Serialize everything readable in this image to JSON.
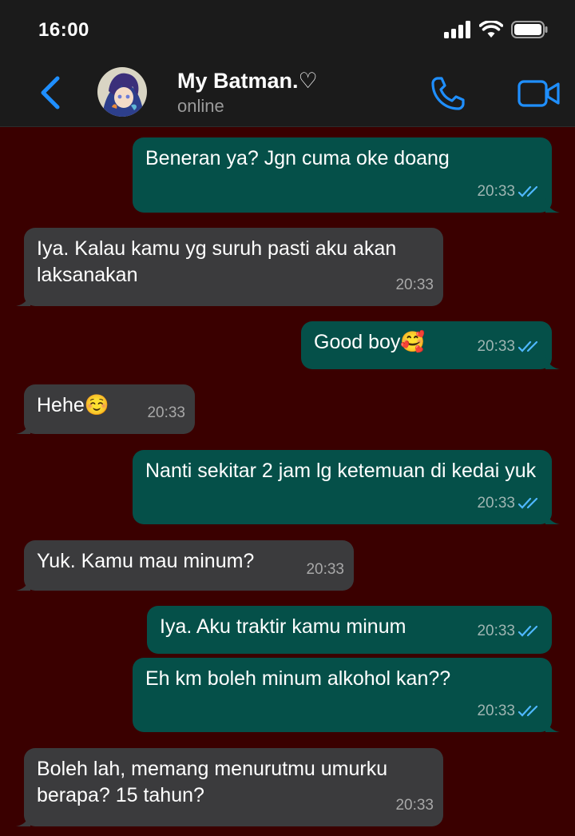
{
  "status_bar": {
    "time": "16:00"
  },
  "header": {
    "contact_name": "My Batman.♡",
    "status": "online"
  },
  "messages": [
    {
      "dir": "out",
      "text": "Beneran ya? Jgn cuma oke doang",
      "time": "20:33"
    },
    {
      "dir": "in",
      "text": "Iya. Kalau kamu yg suruh pasti aku akan laksanakan",
      "time": "20:33"
    },
    {
      "dir": "out",
      "text": "Good boy🥰",
      "time": "20:33"
    },
    {
      "dir": "in",
      "text": "Hehe☺️",
      "time": "20:33"
    },
    {
      "dir": "out",
      "text": "Nanti sekitar 2 jam lg ketemuan di kedai yuk",
      "time": "20:33"
    },
    {
      "dir": "in",
      "text": "Yuk. Kamu mau minum?",
      "time": "20:33"
    },
    {
      "dir": "out",
      "text": "Iya. Aku traktir kamu minum",
      "time": "20:33"
    },
    {
      "dir": "out",
      "text": "Eh km boleh minum alkohol kan??",
      "time": "20:33"
    },
    {
      "dir": "in",
      "text": "Boleh lah, memang menurutmu umurku berapa? 15 tahun?",
      "time": "20:33"
    }
  ],
  "colors": {
    "chat_background": "#3a0000",
    "outgoing_bubble": "#055049",
    "incoming_bubble": "#3b3b3d",
    "accent": "#1f8fff",
    "read_ticks": "#4fb8ff"
  }
}
